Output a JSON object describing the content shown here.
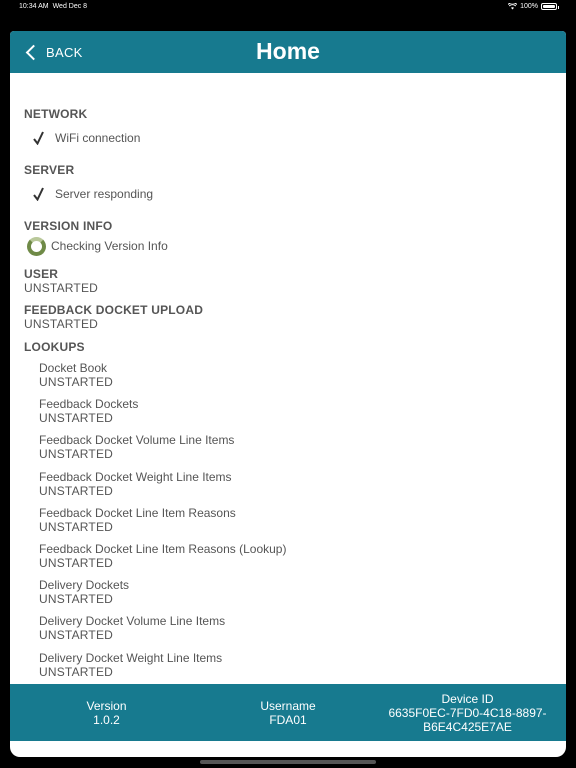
{
  "status_bar": {
    "time": "10:34 AM",
    "date": "Wed Dec 8",
    "battery": "100%"
  },
  "nav": {
    "back_label": "BACK",
    "title": "Home"
  },
  "sections": {
    "network": {
      "heading": "NETWORK",
      "item": "WiFi connection"
    },
    "server": {
      "heading": "SERVER",
      "item": "Server responding"
    },
    "version_info": {
      "heading": "VERSION INFO",
      "item": "Checking Version Info"
    },
    "user": {
      "heading": "USER",
      "status": "UNSTARTED"
    },
    "feedback_upload": {
      "heading": "FEEDBACK DOCKET UPLOAD",
      "status": "UNSTARTED"
    },
    "lookups": {
      "heading": "LOOKUPS",
      "items": [
        {
          "name": "Docket Book",
          "status": "UNSTARTED"
        },
        {
          "name": "Feedback Dockets",
          "status": "UNSTARTED"
        },
        {
          "name": "Feedback Docket Volume Line Items",
          "status": "UNSTARTED"
        },
        {
          "name": "Feedback Docket Weight Line Items",
          "status": "UNSTARTED"
        },
        {
          "name": "Feedback Docket Line Item Reasons",
          "status": "UNSTARTED"
        },
        {
          "name": "Feedback Docket Line Item Reasons (Lookup)",
          "status": "UNSTARTED"
        },
        {
          "name": "Delivery Dockets",
          "status": "UNSTARTED"
        },
        {
          "name": "Delivery Docket Volume Line Items",
          "status": "UNSTARTED"
        },
        {
          "name": "Delivery Docket Weight Line Items",
          "status": "UNSTARTED"
        }
      ]
    }
  },
  "footer": {
    "version_label": "Version",
    "version_value": "1.0.2",
    "username_label": "Username",
    "username_value": "FDA01",
    "device_label": "Device ID",
    "device_value": "6635F0EC-7FD0-4C18-8897-B6E4C425E7AE"
  },
  "colors": {
    "header_bg": "#177a8f",
    "text": "#555555",
    "spinner": "#6f8a47"
  }
}
